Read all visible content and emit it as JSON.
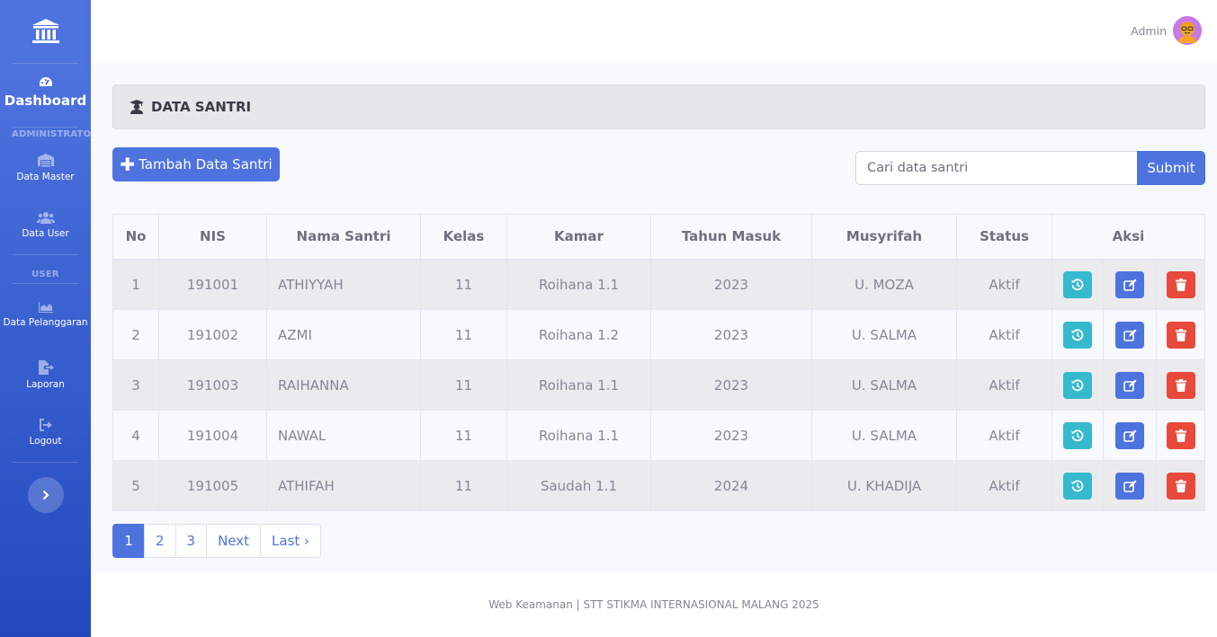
{
  "sidebar": {
    "brand_icon": "bank-icon",
    "dashboard_label": "Dashboard",
    "heading_admin": "ADMINISTRATOR",
    "heading_user": "USER",
    "items": [
      {
        "label": "Data Master",
        "icon": "warehouse-icon"
      },
      {
        "label": "Data User",
        "icon": "users-icon"
      },
      {
        "label": "Data Pelanggaran",
        "icon": "chart-area-icon"
      },
      {
        "label": "Laporan",
        "icon": "file-export-icon"
      },
      {
        "label": "Logout",
        "icon": "sign-out-icon"
      }
    ]
  },
  "topbar": {
    "user_name": "Admin"
  },
  "page": {
    "title": "DATA SANTRI"
  },
  "toolbar": {
    "add_label": "Tambah Data Santri",
    "search_placeholder": "Cari data santri",
    "submit_label": "Submit"
  },
  "table": {
    "headers": [
      "No",
      "NIS",
      "Nama Santri",
      "Kelas",
      "Kamar",
      "Tahun Masuk",
      "Musyrifah",
      "Status",
      "Aksi"
    ],
    "rows": [
      {
        "no": "1",
        "nis": "191001",
        "nama": "ATHIYYAH",
        "kelas": "11",
        "kamar": "Roihana 1.1",
        "tahun": "2023",
        "musyrifah": "U. MOZA",
        "status": "Aktif"
      },
      {
        "no": "2",
        "nis": "191002",
        "nama": "AZMI",
        "kelas": "11",
        "kamar": "Roihana 1.2",
        "tahun": "2023",
        "musyrifah": "U. SALMA",
        "status": "Aktif"
      },
      {
        "no": "3",
        "nis": "191003",
        "nama": "RAIHANNA",
        "kelas": "11",
        "kamar": "Roihana 1.1",
        "tahun": "2023",
        "musyrifah": "U. SALMA",
        "status": "Aktif"
      },
      {
        "no": "4",
        "nis": "191004",
        "nama": "NAWAL",
        "kelas": "11",
        "kamar": "Roihana 1.1",
        "tahun": "2023",
        "musyrifah": "U. SALMA",
        "status": "Aktif"
      },
      {
        "no": "5",
        "nis": "191005",
        "nama": "ATHIFAH",
        "kelas": "11",
        "kamar": "Saudah 1.1",
        "tahun": "2024",
        "musyrifah": "U. KHADIJA",
        "status": "Aktif"
      }
    ]
  },
  "pagination": [
    "1",
    "2",
    "3",
    "Next",
    "Last ›"
  ],
  "footer": {
    "text": "Web Keamanan | STT STIKMA INTERNASIONAL MALANG 2025"
  },
  "colors": {
    "primary": "#4e73df",
    "info": "#36b9cc",
    "danger": "#e74a3b"
  }
}
